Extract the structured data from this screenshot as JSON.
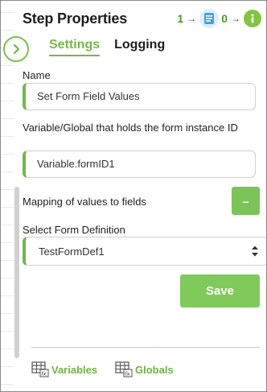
{
  "panel": {
    "title": "Step Properties",
    "flow": {
      "prev_count": "1",
      "next_count": "0",
      "arrow_glyph": "→"
    }
  },
  "tabs": [
    {
      "label": "Settings",
      "active": true
    },
    {
      "label": "Logging",
      "active": false
    }
  ],
  "fields": {
    "name": {
      "label": "Name",
      "value": "Set Form Field Values"
    },
    "instance_var": {
      "label": "Variable/Global that holds the form instance ID",
      "value": "Variable.formID1"
    },
    "mapping": {
      "label": "Mapping of values to fields",
      "button_label": "–"
    },
    "form_definition": {
      "label": "Select Form Definition",
      "selected": "TestFormDef1"
    }
  },
  "actions": {
    "save_label": "Save"
  },
  "footer": {
    "variables_label": "Variables",
    "globals_label": "Globals"
  },
  "icons": {
    "collapse": "chevron-right-icon",
    "form": "form-step-icon",
    "info": "info-icon",
    "select": "updown-arrows-icon",
    "variables": "table-fx-icon",
    "globals": "table-fx-icon"
  },
  "colors": {
    "accent": "#74b74a",
    "button": "#80c95b",
    "info": "#84c440"
  }
}
